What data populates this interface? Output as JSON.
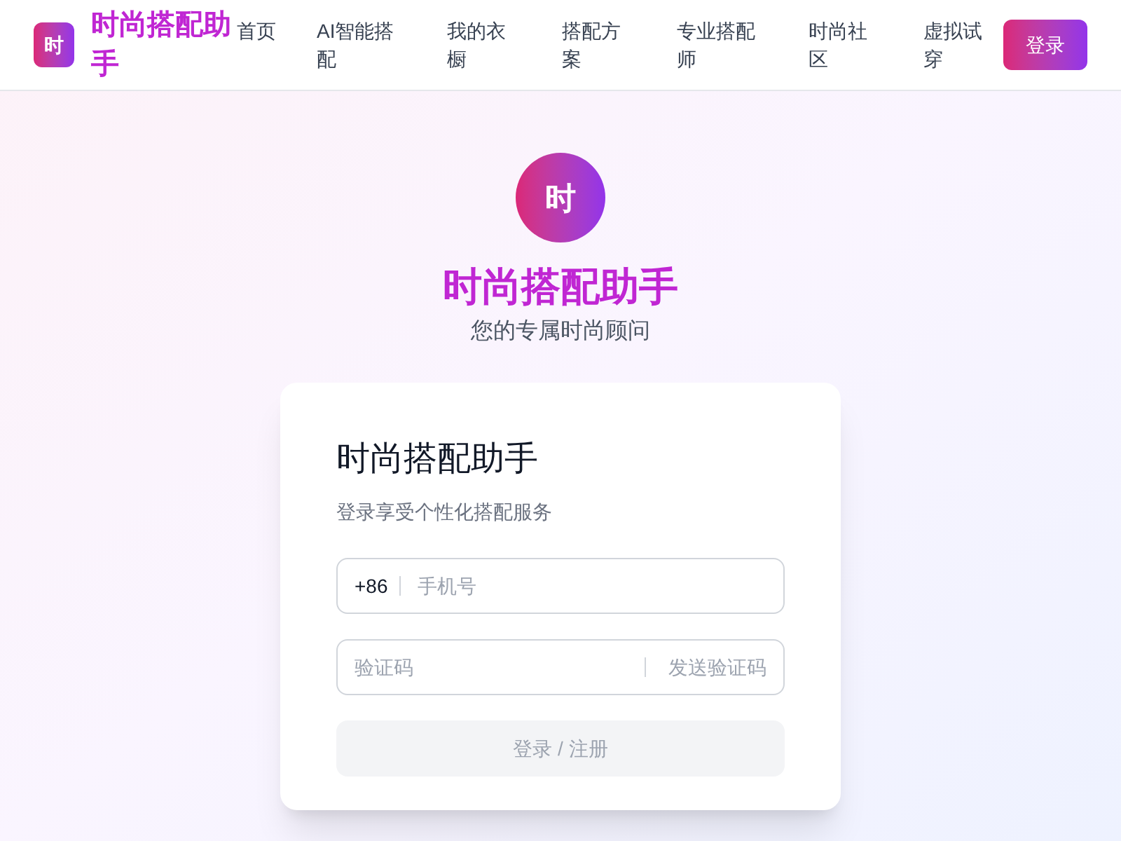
{
  "header": {
    "logo_mark": "时",
    "brand": "时尚搭配助手",
    "nav": [
      {
        "label": "首页",
        "selected": false
      },
      {
        "label": "AI智能搭配",
        "selected": false
      },
      {
        "label": "我的衣橱",
        "selected": false
      },
      {
        "label": "搭配方案",
        "selected": false
      },
      {
        "label": "专业搭配师",
        "selected": false
      },
      {
        "label": "时尚社区",
        "selected": false
      },
      {
        "label": "虚拟试穿",
        "selected": false
      }
    ],
    "login_button": "登录"
  },
  "hero": {
    "logo_mark": "时",
    "title": "时尚搭配助手",
    "subtitle": "您的专属时尚顾问"
  },
  "card": {
    "title": "时尚搭配助手",
    "subtitle": "登录享受个性化搭配服务",
    "phone": {
      "prefix": "+86",
      "placeholder": "手机号"
    },
    "code": {
      "placeholder": "验证码",
      "send_button": "发送验证码",
      "send_disabled": true
    },
    "submit": {
      "label": "登录 / 注册",
      "disabled": true
    }
  }
}
